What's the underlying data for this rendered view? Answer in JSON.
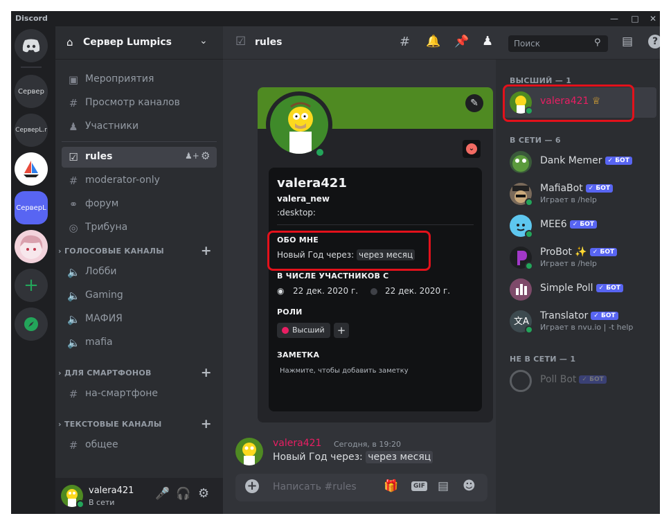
{
  "app": {
    "title": "Discord"
  },
  "servers": [
    "Сервер",
    "СерверL.r",
    "СерверL"
  ],
  "server": {
    "name": "Сервер Lumpics"
  },
  "sidebar": {
    "top_items": [
      "Мероприятия",
      "Просмотр каналов",
      "Участники"
    ],
    "text_channels": [
      "rules",
      "moderator-only",
      "форум",
      "Трибуна"
    ],
    "voice_category": "ГОЛОСОВЫЕ КАНАЛЫ",
    "voice_channels": [
      "Лобби",
      "Gaming",
      "МАФИЯ",
      "mafia"
    ],
    "phone_category": "ДЛЯ СМАРТФОНОВ",
    "phone_channels": [
      "на-смартфоне"
    ],
    "text_category": "ТЕКСТОВЫЕ КАНАЛЫ",
    "text_category_channels": [
      "общее"
    ]
  },
  "user_panel": {
    "name": "valera421",
    "status": "В сети"
  },
  "channel": {
    "name": "rules"
  },
  "search": {
    "placeholder": "Поиск"
  },
  "profile": {
    "display_name": "valera421",
    "username": "valera_new",
    "custom_status": ":desktop:",
    "about_heading": "ОБО МНЕ",
    "about_text": "Новый Год через:",
    "about_highlight": "через месяц",
    "member_since_heading": "В ЧИСЛЕ УЧАСТНИКОВ С",
    "discord_date": "22 дек. 2020 г.",
    "server_date": "22 дек. 2020 г.",
    "roles_heading": "РОЛИ",
    "role_name": "Высший",
    "role_color": "#e91e63",
    "note_heading": "ЗАМЕТКА",
    "note_placeholder": "Нажмите, чтобы добавить заметку"
  },
  "message": {
    "author": "valera421",
    "timestamp": "Сегодня, в 19:20",
    "text": "Новый Год через:",
    "highlight": "через месяц"
  },
  "composer": {
    "placeholder": "Написать #rules"
  },
  "members": {
    "group_top": "ВЫСШИЙ — 1",
    "top_member": "valera421",
    "group_online": "В СЕТИ — 6",
    "online": [
      {
        "name": "Dank Memer",
        "badge": "БОТ",
        "activity": ""
      },
      {
        "name": "MafiaBot",
        "badge": "БОТ",
        "activity": "Играет в /help"
      },
      {
        "name": "MEE6",
        "badge": "БОТ",
        "activity": ""
      },
      {
        "name": "ProBot ✨",
        "badge": "БОТ",
        "activity": "Играет в /help"
      },
      {
        "name": "Simple Poll",
        "badge": "БОТ",
        "activity": ""
      },
      {
        "name": "Translator",
        "badge": "БОТ",
        "activity": "Играет в nvu.io | -t help"
      }
    ],
    "group_offline": "НЕ В СЕТИ — 1",
    "offline": [
      {
        "name": "Poll Bot",
        "badge": "БОТ"
      }
    ]
  },
  "colors": {
    "accent": "#5865f2",
    "online": "#23a55a",
    "role_member": "#e91e63",
    "highlight": "#e3111b"
  }
}
